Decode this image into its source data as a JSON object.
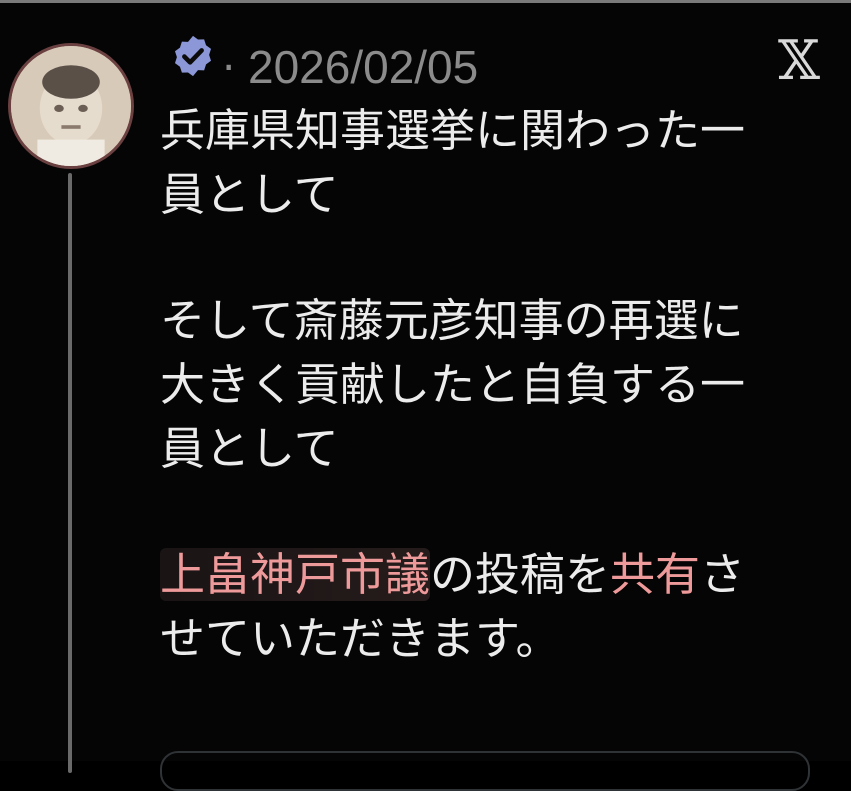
{
  "post": {
    "date": "2026/02/05",
    "separator": "·",
    "platform_logo": "x-logo",
    "paragraph1_line1": "兵庫県知事選挙に関わった一",
    "paragraph1_line2": "員として",
    "paragraph2_line1": "そして斎藤元彦知事の再選に",
    "paragraph2_line2": "大きく貢献したと自負する一",
    "paragraph2_line3": "員として",
    "paragraph3_hl1": "上畠神戸市議",
    "paragraph3_mid": "の投稿を",
    "paragraph3_hl2": "共有",
    "paragraph3_end": "さ",
    "paragraph3_line2": "せていただきます。"
  },
  "colors": {
    "background": "#000000",
    "text": "#ececec",
    "muted": "#8b8b8b",
    "highlight": "#ef9a9a",
    "verified": "#8b97d6"
  }
}
